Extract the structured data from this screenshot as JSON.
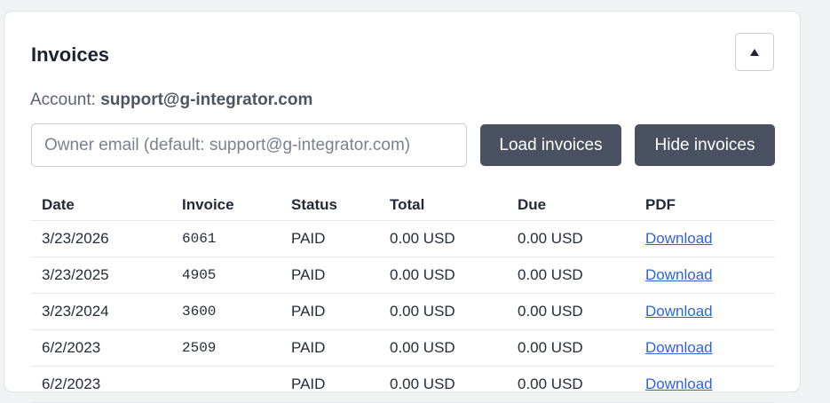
{
  "card": {
    "title": "Invoices",
    "account_label": "Account:",
    "account_email": "support@g-integrator.com"
  },
  "form": {
    "owner_placeholder": "Owner email (default: support@g-integrator.com)",
    "owner_value": "",
    "load_label": "Load invoices",
    "hide_label": "Hide invoices"
  },
  "table": {
    "headers": {
      "date": "Date",
      "invoice": "Invoice",
      "status": "Status",
      "total": "Total",
      "due": "Due",
      "pdf": "PDF"
    },
    "rows": [
      {
        "date": "3/23/2026",
        "invoice": "6061",
        "status": "PAID",
        "total": "0.00 USD",
        "due": "0.00 USD",
        "pdf": "Download"
      },
      {
        "date": "3/23/2025",
        "invoice": "4905",
        "status": "PAID",
        "total": "0.00 USD",
        "due": "0.00 USD",
        "pdf": "Download"
      },
      {
        "date": "3/23/2024",
        "invoice": "3600",
        "status": "PAID",
        "total": "0.00 USD",
        "due": "0.00 USD",
        "pdf": "Download"
      },
      {
        "date": "6/2/2023",
        "invoice": "2509",
        "status": "PAID",
        "total": "0.00 USD",
        "due": "0.00 USD",
        "pdf": "Download"
      },
      {
        "date": "6/2/2023",
        "invoice": "",
        "status": "PAID",
        "total": "0.00 USD",
        "due": "0.00 USD",
        "pdf": "Download"
      }
    ]
  },
  "icons": {
    "collapse": "triangle-up-icon"
  },
  "colors": {
    "button_bg": "#4a5261",
    "link": "#2f63d8",
    "card_border": "#dfe2e7"
  }
}
